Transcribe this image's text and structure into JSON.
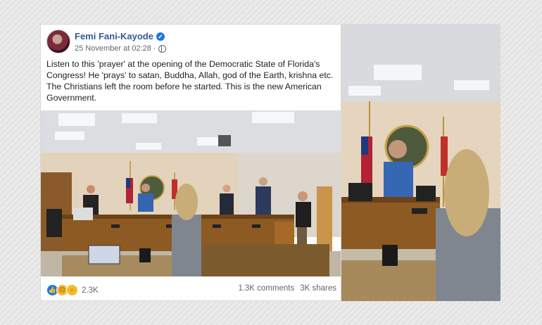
{
  "post": {
    "author": "Femi Fani-Kayode",
    "verified_mark": "✓",
    "timestamp": "25 November at 02:28",
    "privacy_icon": "globe-icon",
    "body": "Listen to this 'prayer' at the opening of the Democratic State of Florida's Congress! He 'prays' to satan, Buddha, Allah, god of the Earth, krishna etc. The Christians left the room before he started. This is the new American Government."
  },
  "footer": {
    "reactions": [
      "like-icon",
      "sad-icon",
      "wow-icon"
    ],
    "reaction_count": "2.3K",
    "comments": "1.3K comments",
    "shares": "3K shares"
  },
  "colors": {
    "author": "#365899",
    "verified": "#1b74e4",
    "background": "#e4e4e4"
  }
}
